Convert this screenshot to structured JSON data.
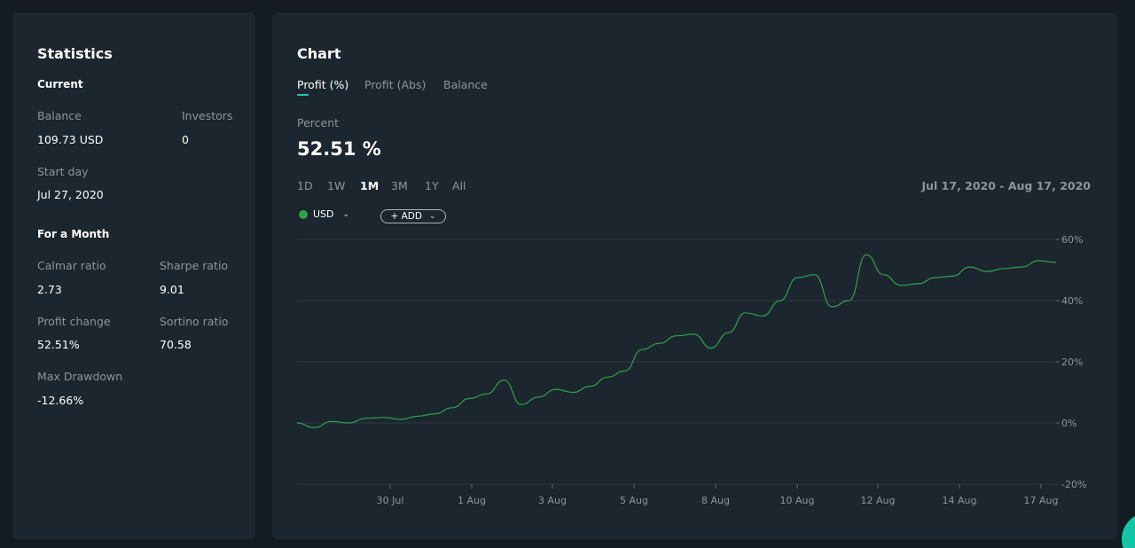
{
  "stats": {
    "title": "Statistics",
    "current": {
      "heading": "Current",
      "balance_label": "Balance",
      "balance_value": "109.73 USD",
      "investors_label": "Investors",
      "investors_value": "0",
      "start_day_label": "Start day",
      "start_day_value": "Jul 27, 2020"
    },
    "month": {
      "heading": "For a Month",
      "calmar_label": "Calmar ratio",
      "calmar_value": "2.73",
      "sharpe_label": "Sharpe ratio",
      "sharpe_value": "9.01",
      "profit_change_label": "Profit change",
      "profit_change_value": "52.51%",
      "sortino_label": "Sortino ratio",
      "sortino_value": "70.58",
      "max_drawdown_label": "Max Drawdown",
      "max_drawdown_value": "-12.66%"
    }
  },
  "chart": {
    "title": "Chart",
    "tabs": [
      "Profit (%)",
      "Profit (Abs)",
      "Balance"
    ],
    "active_tab": "Profit (%)",
    "metric_label": "Percent",
    "metric_value": "52.51 %",
    "ranges": [
      "1D",
      "1W",
      "1M",
      "3M",
      "1Y",
      "All"
    ],
    "active_range": "1M",
    "date_range": "Jul 17, 2020 - Aug 17, 2020",
    "series_pill": {
      "label": "USD",
      "color": "#2ea24a"
    },
    "add_button_label": "+ ADD"
  },
  "chart_data": {
    "type": "line",
    "x_tick_labels": [
      "30 Jul",
      "1 Aug",
      "3 Aug",
      "5 Aug",
      "8 Aug",
      "10 Aug",
      "12 Aug",
      "14 Aug",
      "17 Aug"
    ],
    "y_tick_labels": [
      "60%",
      "40%",
      "20%",
      "0%",
      "-20%"
    ],
    "ylim": [
      -20,
      60
    ],
    "grid": true,
    "series": [
      {
        "color": "#2ea24a",
        "x": [
          "Jul 27",
          "Jul 27",
          "Jul 28",
          "Jul 28",
          "Jul 29",
          "Jul 29",
          "Jul 30",
          "Jul 30",
          "Jul 31",
          "Jul 31",
          "Aug 1",
          "Aug 1",
          "Aug 2",
          "Aug 2",
          "Aug 2",
          "Aug 3",
          "Aug 3",
          "Aug 4",
          "Aug 4",
          "Aug 5",
          "Aug 5",
          "Aug 6",
          "Aug 6",
          "Aug 7",
          "Aug 7",
          "Aug 8",
          "Aug 8",
          "Aug 9",
          "Aug 9",
          "Aug 10",
          "Aug 10",
          "Aug 11",
          "Aug 11",
          "Aug 12",
          "Aug 12",
          "Aug 13",
          "Aug 13",
          "Aug 14",
          "Aug 14",
          "Aug 15",
          "Aug 15",
          "Aug 16",
          "Aug 16",
          "Aug 17",
          "Aug 17"
        ],
        "values": [
          0,
          -1.5,
          0.5,
          0,
          1.5,
          1.8,
          1.2,
          2.2,
          3,
          5,
          8,
          9.5,
          14,
          6,
          8.5,
          11,
          10,
          12,
          15,
          17,
          24,
          26,
          28.5,
          29,
          24.5,
          29.5,
          36,
          35,
          40,
          47.5,
          48.5,
          38,
          40,
          55,
          48.5,
          45,
          45.5,
          47.5,
          48,
          51,
          49.5,
          50.5,
          51,
          53,
          52.5
        ]
      }
    ]
  }
}
